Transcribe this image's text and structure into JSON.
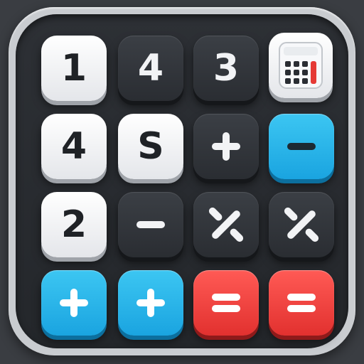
{
  "app": {
    "name": "calculator-app-icon"
  },
  "colors": {
    "background": "#3a3d42",
    "frame": "#c9ccd0",
    "panel": "#2b2e33",
    "light_key": "#f4f5f7",
    "dark_key": "#33363b",
    "blue_key": "#2bb6ea",
    "red_key": "#f0433f",
    "calc_icon_red": "#e53935"
  },
  "keys": {
    "row1": {
      "k1": "1",
      "k2": "4",
      "k3": "3",
      "k4_icon": "calculator-icon"
    },
    "row2": {
      "k1": "4",
      "k2": "S",
      "k3_icon": "plus-icon",
      "k4_icon": "minus-icon"
    },
    "row3": {
      "k1": "2",
      "k2_icon": "minus-icon",
      "k3_icon": "multiply-icon",
      "k4_icon": "multiply-icon"
    },
    "row4": {
      "k1_icon": "plus-icon",
      "k2_icon": "plus-icon",
      "k3_icon": "equals-icon",
      "k4_icon": "equals-icon"
    }
  }
}
